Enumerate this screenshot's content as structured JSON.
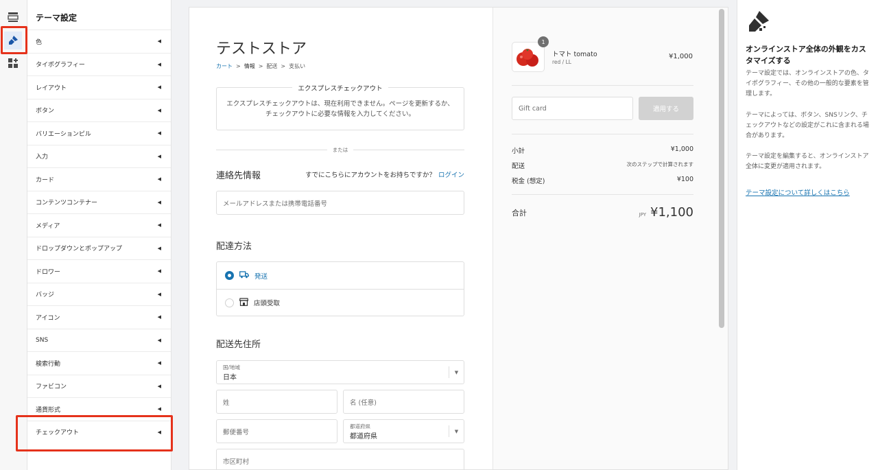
{
  "rail": {
    "icons": [
      "sections-icon",
      "theme-settings-brush-icon",
      "app-blocks-icon"
    ]
  },
  "sidebar": {
    "title": "テーマ設定",
    "items": [
      {
        "label": "色"
      },
      {
        "label": "タイポグラフィー"
      },
      {
        "label": "レイアウト"
      },
      {
        "label": "ボタン"
      },
      {
        "label": "バリエーションピル"
      },
      {
        "label": "入力"
      },
      {
        "label": "カード"
      },
      {
        "label": "コンテンツコンテナー"
      },
      {
        "label": "メディア"
      },
      {
        "label": "ドロップダウンとポップアップ"
      },
      {
        "label": "ドロワー"
      },
      {
        "label": "バッジ"
      },
      {
        "label": "アイコン"
      },
      {
        "label": "SNS"
      },
      {
        "label": "検索行動"
      },
      {
        "label": "ファビコン"
      },
      {
        "label": "通貨形式"
      },
      {
        "label": "チェックアウト"
      }
    ]
  },
  "checkout": {
    "store_name": "テストストア",
    "breadcrumb": [
      "カート",
      "情報",
      "配送",
      "支払い"
    ],
    "express": {
      "title": "エクスプレスチェックアウト",
      "message": "エクスプレスチェックアウトは、現在利用できません。ページを更新するか、チェックアウトに必要な情報を入力してください。"
    },
    "or_label": "または",
    "contact": {
      "title": "連絡先情報",
      "login_prompt": "すでにこちらにアカウントをお持ちですか？",
      "login_link": "ログイン",
      "email_placeholder": "メールアドレスまたは携帯電話番号"
    },
    "delivery": {
      "title": "配達方法",
      "options": [
        {
          "label": "発送",
          "selected": true
        },
        {
          "label": "店頭受取",
          "selected": false
        }
      ]
    },
    "address": {
      "title": "配送先住所",
      "country_label": "国/地域",
      "country_value": "日本",
      "last_name_placeholder": "姓",
      "first_name_placeholder": "名 (任意)",
      "postal_placeholder": "郵便番号",
      "prefecture_label": "都道府県",
      "prefecture_value": "都道府県",
      "city_placeholder": "市区町村"
    }
  },
  "summary": {
    "product": {
      "quantity": "1",
      "name": "トマト tomato",
      "variant": "red / LL",
      "price": "¥1,000"
    },
    "gift_card_placeholder": "Gift card",
    "apply_label": "適用する",
    "subtotal_label": "小計",
    "subtotal_value": "¥1,000",
    "shipping_label": "配送",
    "shipping_value": "次のステップで計算されます",
    "tax_label": "税金 (想定)",
    "tax_value": "¥100",
    "total_label": "合計",
    "total_currency": "JPY",
    "total_value": "¥1,100"
  },
  "help": {
    "title": "オンラインストア全体の外観をカスタマイズする",
    "paragraph1": "テーマ設定では、オンラインストアの色、タイポグラフィー、その他の一般的な要素を管理します。",
    "paragraph2": "テーマによっては、ボタン、SNSリンク、チェックアウトなどの設定がこれに含まれる場合があります。",
    "paragraph3": "テーマ設定を編集すると、オンラインストア全体に変更が適用されます。",
    "link": "テーマ設定について詳しくはこちら"
  },
  "colors": {
    "accent": "#1773b0",
    "highlight": "#e5321b"
  }
}
